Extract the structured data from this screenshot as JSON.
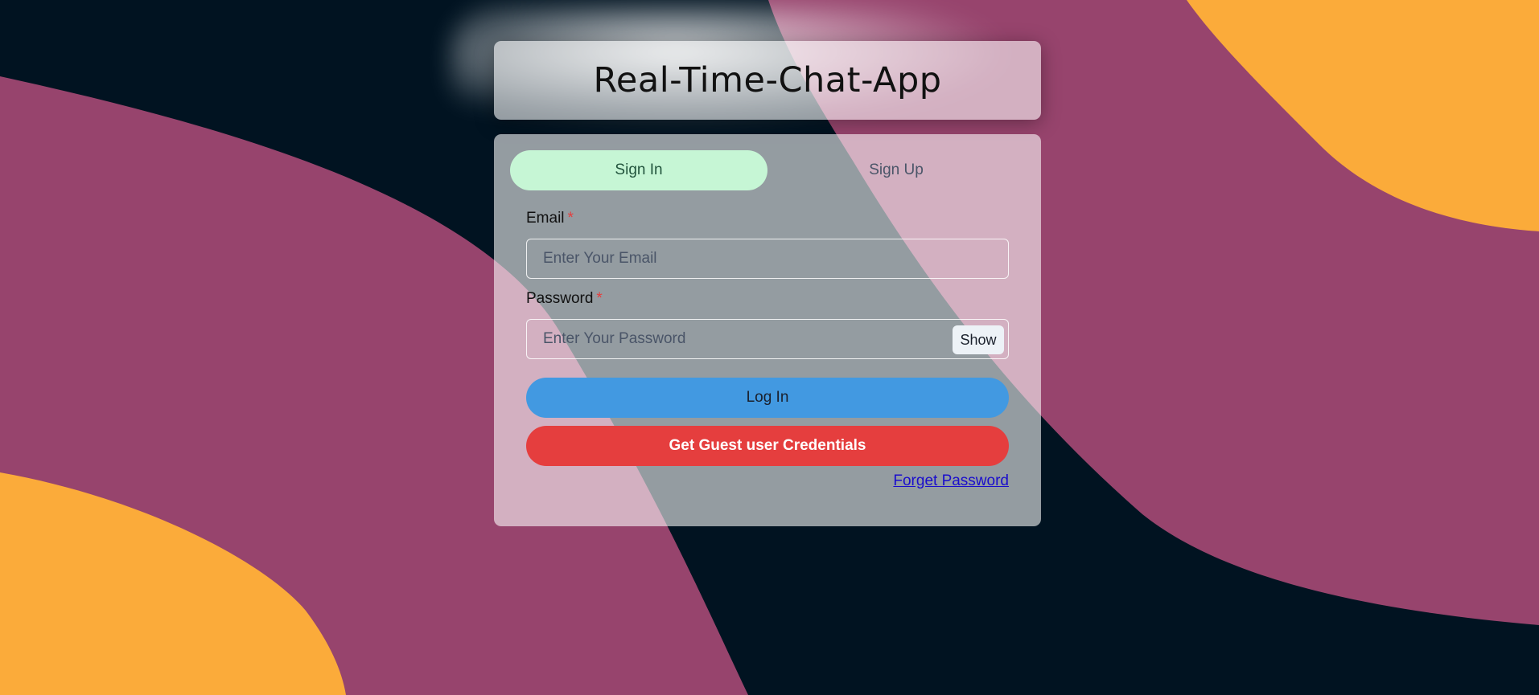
{
  "app": {
    "title": "Real-Time-Chat-App"
  },
  "tabs": [
    {
      "label": "Sign In",
      "active": true
    },
    {
      "label": "Sign Up",
      "active": false
    }
  ],
  "email": {
    "label": "Email",
    "required_mark": "*",
    "placeholder": "Enter Your Email",
    "value": ""
  },
  "password": {
    "label": "Password",
    "required_mark": "*",
    "placeholder": "Enter Your Password",
    "value": "",
    "toggle_label": "Show"
  },
  "buttons": {
    "login": "Log In",
    "guest": "Get Guest user Credentials"
  },
  "links": {
    "forget_password": "Forget Password"
  },
  "colors": {
    "background": "#011321",
    "wave_magenta": "#97446d",
    "wave_orange": "#fbab3a",
    "tab_active": "#c6f6d5",
    "login_button": "#4299e1",
    "guest_button": "#e53e3e"
  }
}
